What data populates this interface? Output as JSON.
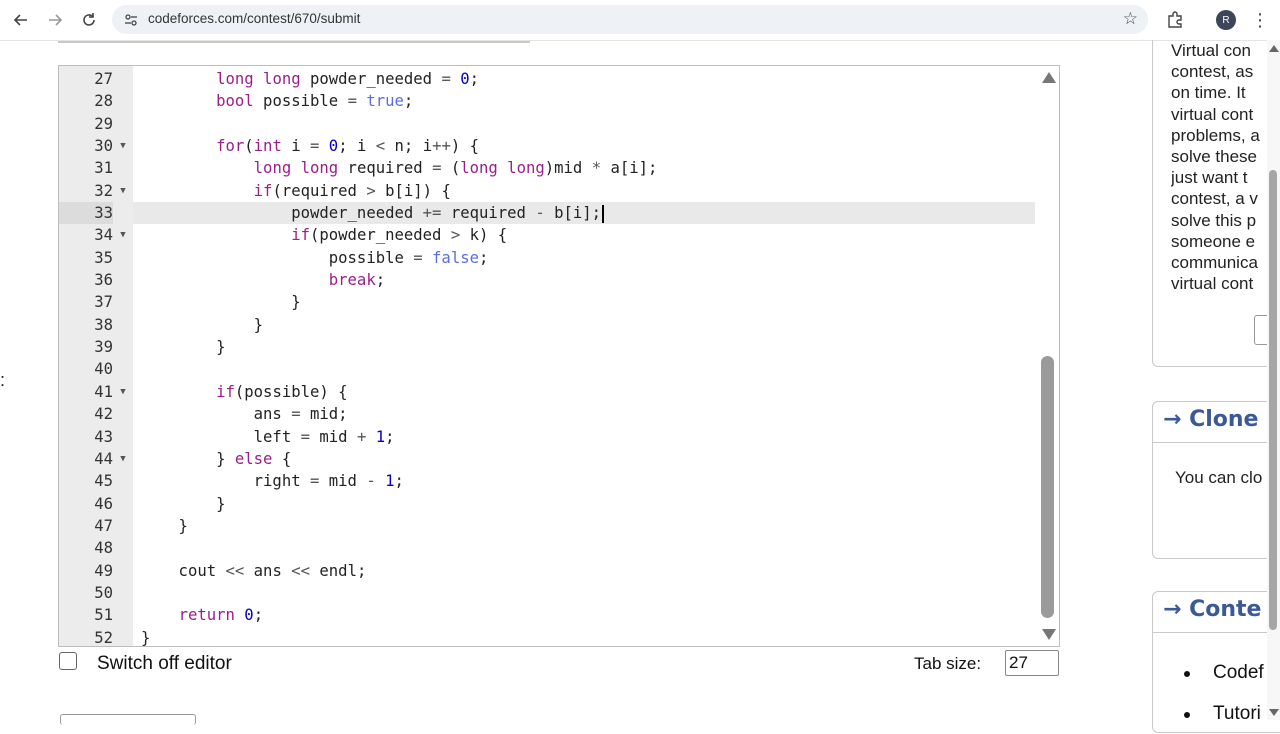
{
  "browser": {
    "url": "codeforces.com/contest/670/submit",
    "avatar_letter": "R",
    "icons": [
      "back-arrow-icon",
      "forward-arrow-icon",
      "reload-icon",
      "site-settings-icon",
      "star-icon",
      "extensions-icon",
      "menu-dots-icon"
    ]
  },
  "editor": {
    "lines": [
      {
        "n": "27",
        "fold": false,
        "html": "        <span class='ty'>long long</span> powder_needed <span class='op'>=</span> <span class='num'>0</span>;"
      },
      {
        "n": "28",
        "fold": false,
        "html": "        <span class='ty'>bool</span> possible <span class='op'>=</span> <span class='bool'>true</span>;"
      },
      {
        "n": "29",
        "fold": false,
        "html": ""
      },
      {
        "n": "30",
        "fold": true,
        "html": "        <span class='kw'>for</span>(<span class='ty'>int</span> i <span class='op'>=</span> <span class='num'>0</span>; i <span class='op'>&lt;</span> n; i<span class='op'>++</span>) {"
      },
      {
        "n": "31",
        "fold": false,
        "html": "            <span class='ty'>long long</span> required <span class='op'>=</span> (<span class='ty'>long long</span>)mid <span class='op'>*</span> a[i];"
      },
      {
        "n": "32",
        "fold": true,
        "html": "            <span class='kw'>if</span>(required <span class='op'>&gt;</span> b[i]) {"
      },
      {
        "n": "33",
        "fold": false,
        "active": true,
        "html": "                powder_needed <span class='op'>+=</span> required <span class='op'>-</span> b[i];<span class='caret'></span>"
      },
      {
        "n": "34",
        "fold": true,
        "html": "                <span class='kw'>if</span>(powder_needed <span class='op'>&gt;</span> k) {"
      },
      {
        "n": "35",
        "fold": false,
        "html": "                    possible <span class='op'>=</span> <span class='bool'>false</span>;"
      },
      {
        "n": "36",
        "fold": false,
        "html": "                    <span class='kw'>break</span>;"
      },
      {
        "n": "37",
        "fold": false,
        "html": "                }"
      },
      {
        "n": "38",
        "fold": false,
        "html": "            }"
      },
      {
        "n": "39",
        "fold": false,
        "html": "        }"
      },
      {
        "n": "40",
        "fold": false,
        "html": ""
      },
      {
        "n": "41",
        "fold": true,
        "html": "        <span class='kw'>if</span>(possible) {"
      },
      {
        "n": "42",
        "fold": false,
        "html": "            ans <span class='op'>=</span> mid;"
      },
      {
        "n": "43",
        "fold": false,
        "html": "            left <span class='op'>=</span> mid <span class='op'>+</span> <span class='num'>1</span>;"
      },
      {
        "n": "44",
        "fold": true,
        "html": "        } <span class='kw'>else</span> {"
      },
      {
        "n": "45",
        "fold": false,
        "html": "            right <span class='op'>=</span> mid <span class='op'>-</span> <span class='num'>1</span>;"
      },
      {
        "n": "46",
        "fold": false,
        "html": "        }"
      },
      {
        "n": "47",
        "fold": false,
        "html": "    }"
      },
      {
        "n": "48",
        "fold": false,
        "html": ""
      },
      {
        "n": "49",
        "fold": false,
        "html": "    cout <span class='op'>&lt;&lt;</span> ans <span class='op'>&lt;&lt;</span> endl;"
      },
      {
        "n": "50",
        "fold": false,
        "html": ""
      },
      {
        "n": "51",
        "fold": false,
        "html": "    <span class='kw'>return</span> <span class='num'>0</span>;"
      },
      {
        "n": "52",
        "fold": false,
        "html": "}"
      }
    ]
  },
  "controls": {
    "switch_off_label": "Switch off editor",
    "tab_size_label": "Tab size:",
    "tab_size_value": "27"
  },
  "sidebar": {
    "virtual_text_lines": [
      "Virtual con",
      "contest, as",
      "on time. It",
      "virtual cont",
      "problems, a",
      "solve these",
      "just want t",
      "contest, a v",
      "solve this p",
      "someone e",
      "communica",
      "virtual cont"
    ],
    "clone_title": "→ Clone",
    "clone_body": "You can clo",
    "contest_title": "→ Conte",
    "contest_items": [
      "Codef",
      "Tutori"
    ]
  },
  "left_colon": ":"
}
